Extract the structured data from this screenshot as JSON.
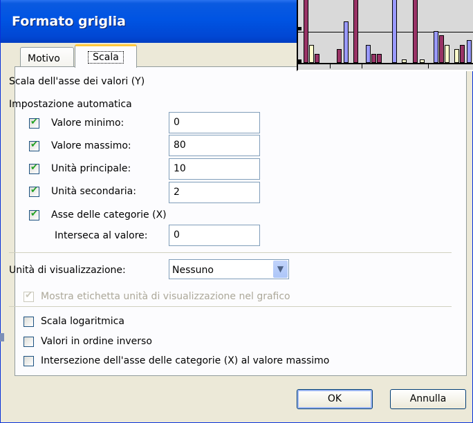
{
  "window": {
    "title": "Formato griglia"
  },
  "tabs": [
    {
      "label": "Motivo",
      "active": false
    },
    {
      "label": "Scala",
      "active": true
    }
  ],
  "scale": {
    "heading": "Scala dell'asse dei valori (Y)",
    "auto_heading": "Impostazione automatica",
    "min": {
      "label": "Valore minimo:",
      "checked": true,
      "value": "0"
    },
    "max": {
      "label": "Valore massimo:",
      "checked": true,
      "value": "80"
    },
    "major": {
      "label": "Unità principale:",
      "checked": true,
      "value": "10"
    },
    "minor": {
      "label": "Unità secondaria:",
      "checked": true,
      "value": "2"
    },
    "category_axis": {
      "label": "Asse delle categorie (X)",
      "checked": true
    },
    "crosses": {
      "label": "Interseca al valore:",
      "value": "0"
    },
    "display_units": {
      "label": "Unità di visualizzazione:",
      "value": "Nessuno"
    },
    "show_units_label": {
      "label": "Mostra etichetta unità di visualizzazione nel grafico",
      "checked": true,
      "enabled": false
    },
    "log_scale": {
      "label": "Scala logaritmica",
      "checked": false
    },
    "reverse": {
      "label": "Valori in ordine inverso",
      "checked": false
    },
    "cross_at_max": {
      "label": "Intersezione dell'asse delle categorie (X) al valore massimo",
      "checked": false
    }
  },
  "buttons": {
    "ok": "OK",
    "cancel": "Annulla"
  },
  "colors": {
    "titlebar": "#0054e3",
    "dialog": "#ece9d8",
    "check": "#21a121",
    "tab_highlight": "#ffc83c"
  }
}
